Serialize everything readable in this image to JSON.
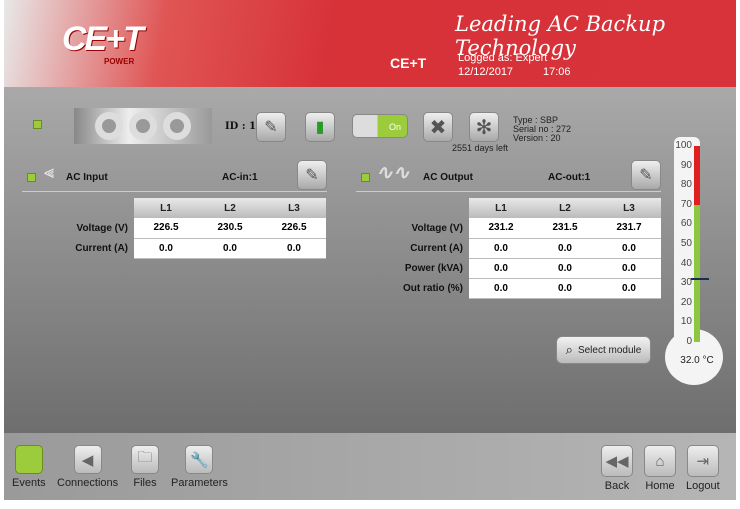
{
  "header": {
    "logo": "CE+T",
    "logo_sub": "POWER",
    "tagline": "Leading AC Backup Technology",
    "brand": "CE+T",
    "logged_as": "Logged as: Expert",
    "date": "12/12/2017",
    "time": "17:06"
  },
  "module": {
    "id_label": "ID : 1",
    "toggle": "On",
    "type": "Type : SBP",
    "serial": "Serial no : 272",
    "version": "Version : 20",
    "days_left": "2551 days left"
  },
  "ac_input": {
    "title": "AC Input",
    "id": "AC-in:1",
    "columns": [
      "L1",
      "L2",
      "L3"
    ],
    "rows": [
      {
        "label": "Voltage (V)",
        "values": [
          "226.5",
          "230.5",
          "226.5"
        ]
      },
      {
        "label": "Current (A)",
        "values": [
          "0.0",
          "0.0",
          "0.0"
        ]
      }
    ]
  },
  "ac_output": {
    "title": "AC Output",
    "id": "AC-out:1",
    "columns": [
      "L1",
      "L2",
      "L3"
    ],
    "rows": [
      {
        "label": "Voltage (V)",
        "values": [
          "231.2",
          "231.5",
          "231.7"
        ]
      },
      {
        "label": "Current (A)",
        "values": [
          "0.0",
          "0.0",
          "0.0"
        ]
      },
      {
        "label": "Power (kVA)",
        "values": [
          "0.0",
          "0.0",
          "0.0"
        ]
      },
      {
        "label": "Out ratio (%)",
        "values": [
          "0.0",
          "0.0",
          "0.0"
        ]
      }
    ]
  },
  "select_module": "Select module",
  "thermometer": {
    "ticks": [
      "100",
      "90",
      "80",
      "70",
      "60",
      "50",
      "40",
      "30",
      "20",
      "10",
      "0"
    ],
    "value": 32.0,
    "readout": "32.0 °C",
    "warn_threshold": 70,
    "colors": {
      "ok": "#8dc63f",
      "warn": "#e02020"
    }
  },
  "toolbar": {
    "events": "Events",
    "connections": "Connections",
    "files": "Files",
    "parameters": "Parameters",
    "back": "Back",
    "home": "Home",
    "logout": "Logout"
  }
}
